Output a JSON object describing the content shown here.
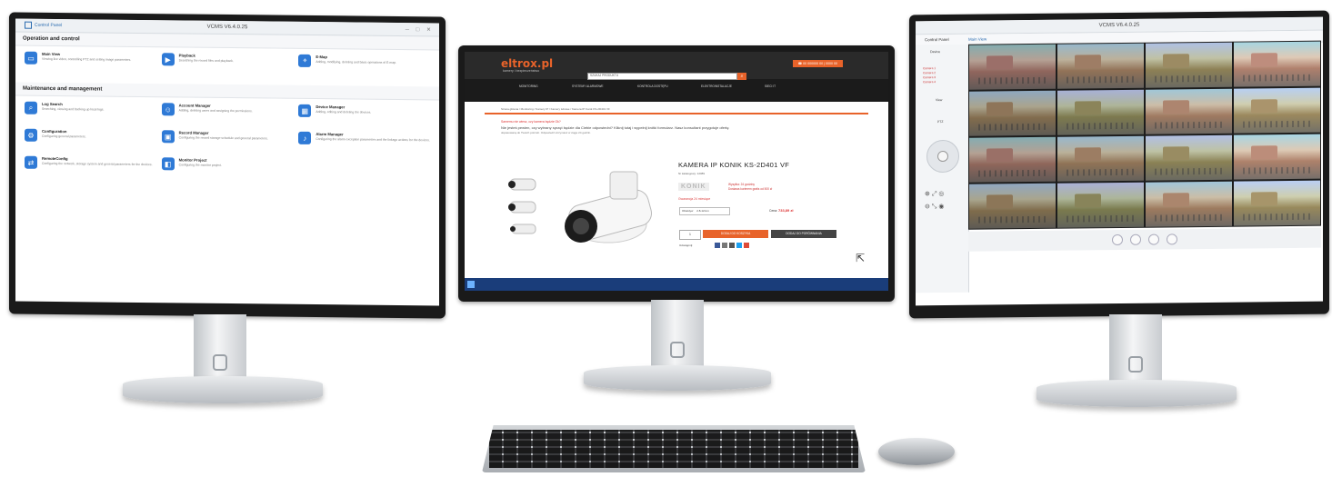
{
  "left_app": {
    "title": "VCMS V6.4.0.25",
    "tab": "Control Panel",
    "sections": [
      {
        "label": "Operation and control",
        "modules": [
          {
            "name": "Main View",
            "desc": "Viewing live video, controlling PTZ and setting image parameters.",
            "icon": "monitor-icon"
          },
          {
            "name": "Playback",
            "desc": "Searching the record files and playback.",
            "icon": "play-icon"
          },
          {
            "name": "E-Map",
            "desc": "Adding, modifying, deleting and basic operations of E-map.",
            "icon": "map-icon"
          }
        ]
      },
      {
        "label": "Maintenance and management",
        "modules": [
          {
            "name": "Log Search",
            "desc": "Searching, viewing and backing up local logs.",
            "icon": "search-icon"
          },
          {
            "name": "Account Manager",
            "desc": "Adding, deleting users and assigning the permissions.",
            "icon": "users-icon"
          },
          {
            "name": "Device Manager",
            "desc": "Adding, editing and deleting the devices.",
            "icon": "device-icon"
          },
          {
            "name": "Configuration",
            "desc": "Configuring general parameters.",
            "icon": "gear-icon"
          },
          {
            "name": "Record Manager",
            "desc": "Configuring the record storage schedule and general parameters.",
            "icon": "record-icon"
          },
          {
            "name": "Alarm Manager",
            "desc": "Configuring the alarm exception parameters and the linkage actions for the devices.",
            "icon": "bell-icon"
          },
          {
            "name": "RemoteConfig",
            "desc": "Configuring the network, storage system and general parameters for the devices.",
            "icon": "remote-icon"
          },
          {
            "name": "Monitor Project",
            "desc": "Configuring the monitor project.",
            "icon": "project-icon"
          }
        ]
      }
    ]
  },
  "center_site": {
    "logo": "eltrox.pl",
    "tagline": "kamery i bezpieczeństwo",
    "hotline": "☎ 00 000000 00 | 0000 00",
    "search_placeholder": "SZUKAJ PRODUKTU",
    "nav": [
      "MONITORING",
      "SYSTEMY ALARMOWE",
      "KONTROLA DOSTĘPU",
      "ELEKTROINSTALACJE",
      "SIECI IT"
    ],
    "breadcrumb": "Strona główna / Monitoring / Kamery IP / Kamery tubowe / Kamera IP Konik KS-2D401 VF",
    "notice_red": "Samemu nie wiesz, czy kamera będzie Ok?",
    "notice_text": "Nie jesteś pewien, czy wybrany sprzęt będzie dla Ciebie odpowiedni? Kliknij tutaj i wypełnij krótki formularz. Nasz konsultant przygotuje ofertę",
    "notice_sub": "dopasowaną do Twoich potrzeb. Odpowiedź otrzymasz w ciągu 24 godzin.",
    "title": "KAMERA IP KONIK KS-2D401 VF",
    "sku": "Nr katalogowy: 12089",
    "brand": "KONIK",
    "availability": [
      "Wysyłka: 24 godziny",
      "Dostawa kurierem gratis od 500 zł"
    ],
    "warranty": "Gwarancja 24 miesiące",
    "option_label": "Obiektyw",
    "option_value": "2.8-12mm",
    "price_label": "Cena:",
    "price": "733,89 zł",
    "qty": "1",
    "add_to_cart": "DODAJ DO KOSZYKA",
    "compare": "DODAJ DO PORÓWNANIA",
    "share_label": "Udostępnij:"
  },
  "right_app": {
    "title": "VCMS V6.4.0.25",
    "tabs": [
      "Control Panel",
      "Main View"
    ],
    "device_tree_label": "Device",
    "devices": [
      "Camera 1",
      "Camera 2",
      "Camera 3",
      "Camera 4"
    ],
    "ptz_label": "PTZ",
    "view_label": "View",
    "grid_size": 16
  },
  "colors": {
    "accent_orange": "#e8632a",
    "vcms_blue": "#2f7ad6",
    "taskbar_blue": "#1a3d7a"
  }
}
